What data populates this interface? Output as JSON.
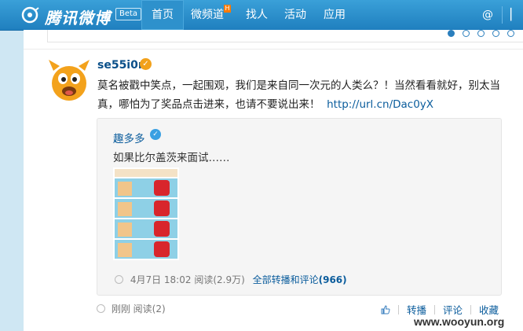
{
  "nav": {
    "brand": "腾讯微博",
    "beta": "Beta",
    "items": [
      {
        "label": "首页",
        "active": true
      },
      {
        "label": "微频道",
        "badge": "H"
      },
      {
        "label": "找人"
      },
      {
        "label": "活动"
      },
      {
        "label": "应用"
      }
    ],
    "at_symbol": "@"
  },
  "post": {
    "username": "se55i0n",
    "verified_icon": "verified-badge-icon",
    "text": "莫名被戳中笑点，一起围观，我们是来自同一次元的人类么？！当然看看就好，别太当真，哪怕为了奖品点击进来，也请不要说出来！",
    "link": "http://url.cn/Dac0yX",
    "quote": {
      "username": "趣多多",
      "text": "如果比尔盖茨来面试……",
      "time": "4月7日 18:02",
      "reads": "阅读(2.9万)",
      "all_link": "全部转播和评论",
      "all_count": "(966)"
    },
    "time": "刚刚",
    "reads": "阅读(2)",
    "actions": {
      "retweet": "转播",
      "comment": "评论",
      "favorite": "收藏"
    }
  },
  "watermark": "www.wooyun.org",
  "colors": {
    "nav": "#2089c9",
    "link": "#0a5c9c",
    "accent_badge": "#f2a11b"
  }
}
